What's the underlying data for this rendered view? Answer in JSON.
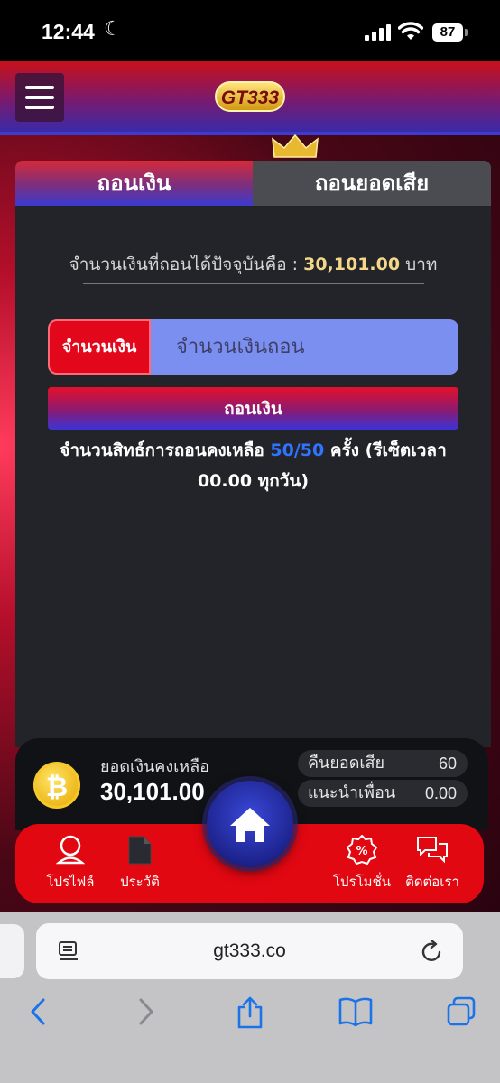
{
  "status_bar": {
    "time": "12:44",
    "battery": "87",
    "icons": [
      "moon-icon",
      "cellular-signal-icon",
      "wifi-icon",
      "battery-icon"
    ]
  },
  "header": {
    "menu_icon": "hamburger-menu-icon",
    "logo_text": "GT333"
  },
  "tabs": [
    {
      "label": "ถอนเงิน",
      "active": true
    },
    {
      "label": "ถอนยอดเสีย",
      "active": false
    }
  ],
  "withdraw": {
    "available_prefix": "จำนวนเงินที่ถอนได้ปัจจุบันคือ :",
    "available_amount": "30,101.00",
    "available_unit": "บาท",
    "amount_label": "จำนวนเงิน",
    "amount_placeholder": "จำนวนเงินถอน",
    "submit_label": "ถอนเงิน",
    "rights_prefix": "จำนวนสิทธ์การถอนคงเหลือ",
    "rights_count": "50/50",
    "rights_suffix": "ครั้ง (รีเซ็ตเวลา 00.00 ทุกวัน)"
  },
  "balance": {
    "coin_icon": "bitcoin-coin-icon",
    "label": "ยอดเงินคงเหลือ",
    "value": "30,101.00",
    "cashback_label": "คืนยอดเสีย",
    "cashback_value": "60",
    "referral_label": "แนะนำเพื่อน",
    "referral_value": "0.00"
  },
  "bottom_nav": [
    {
      "label": "โปรไฟล์",
      "icon": "profile-icon"
    },
    {
      "label": "ประวัติ",
      "icon": "history-document-icon"
    },
    {
      "label": "โปรโมชั่น",
      "icon": "promotion-percent-icon"
    },
    {
      "label": "ติดต่อเรา",
      "icon": "chat-bubbles-icon"
    }
  ],
  "home_icon": "home-icon",
  "browser": {
    "url": "gt333.co",
    "icons": [
      "reader-icon",
      "reload-icon",
      "back-icon",
      "forward-icon",
      "share-icon",
      "bookmarks-icon",
      "tabs-icon"
    ]
  },
  "colors": {
    "accent_red": "#e10812",
    "accent_blue": "#3b34d6",
    "amount_gold": "#f4d88a",
    "rights_blue": "#2f74ff"
  }
}
